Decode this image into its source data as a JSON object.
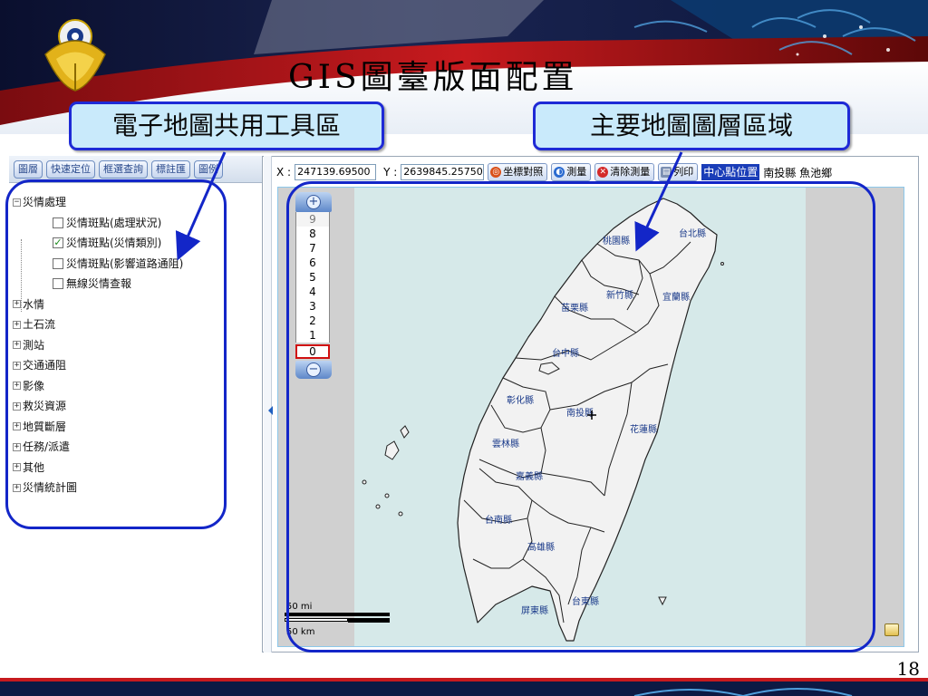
{
  "slide": {
    "title": "GIS圖臺版面配置",
    "page_number": "18",
    "callouts": {
      "toolbar_area": "電子地圖共用工具區",
      "map_layer_area": "主要地圖圖層區域"
    }
  },
  "left_toolbar": {
    "tabs": [
      "圖層",
      "快速定位",
      "框選查詢",
      "標註匯",
      "圖例"
    ]
  },
  "layer_tree": {
    "root_expanded": {
      "label": "災情處理",
      "expander": "−",
      "children": [
        {
          "label": "災情斑點(處理狀況)",
          "checked": false
        },
        {
          "label": "災情斑點(災情類別)",
          "checked": true
        },
        {
          "label": "災情斑點(影響道路通阻)",
          "checked": false
        },
        {
          "label": "無線災情查報",
          "checked": false
        }
      ]
    },
    "collapsed": [
      {
        "label": "水情",
        "expander": "+"
      },
      {
        "label": "土石流",
        "expander": "+"
      },
      {
        "label": "測站",
        "expander": "+"
      },
      {
        "label": "交通通阻",
        "expander": "+"
      },
      {
        "label": "影像",
        "expander": "+"
      },
      {
        "label": "救災資源",
        "expander": "+"
      },
      {
        "label": "地質斷層",
        "expander": "+"
      },
      {
        "label": "任務/派遣",
        "expander": "+"
      },
      {
        "label": "其他",
        "expander": "+"
      },
      {
        "label": "災情統計圖",
        "expander": "+"
      }
    ]
  },
  "map_toolbar": {
    "x_label": "X :",
    "x_value": "247139.69500",
    "y_label": "Y :",
    "y_value": "2639845.25750",
    "buttons": [
      "坐標對照",
      "測量",
      "清除測量",
      "列印"
    ],
    "center_label": "中心點位置",
    "center_value": "南投縣 魚池鄉"
  },
  "zoom": {
    "levels": [
      "9",
      "8",
      "7",
      "6",
      "5",
      "4",
      "3",
      "2",
      "1",
      "0"
    ],
    "selected": "0",
    "in_symbol": "+",
    "out_symbol": "−"
  },
  "scale_bar": {
    "miles": "50 mi",
    "km": "50 km"
  },
  "map_labels": {
    "taoyuan": "桃園縣",
    "taipei": "台北縣",
    "hsinchu": "新竹縣",
    "yilan": "宜蘭縣",
    "miaoli": "苗栗縣",
    "taichung": "台中縣",
    "changhua": "彰化縣",
    "nantou": "南投縣",
    "hualien": "花蓮縣",
    "yunlin": "雲林縣",
    "chiayi": "嘉義縣",
    "tainan": "台南縣",
    "kaohsiung": "高雄縣",
    "pingtung": "屏東縣",
    "taitung": "台東縣"
  },
  "colors": {
    "callout_fill": "#c9eafb",
    "callout_border": "#1e2ad6",
    "ring": "#1326c8",
    "sea": "#d6e9e9",
    "land": "#f2f2f2",
    "map_label": "#1a3a8a",
    "center_highlight": "#1a3db8"
  },
  "icons": {
    "coord_button": "globe-icon",
    "measure_button": "ruler-icon",
    "clear_button": "clear-x-icon",
    "print_button": "printer-icon",
    "overview_button": "overview-map-icon",
    "emblem": "phoenix-emblem-logo"
  }
}
